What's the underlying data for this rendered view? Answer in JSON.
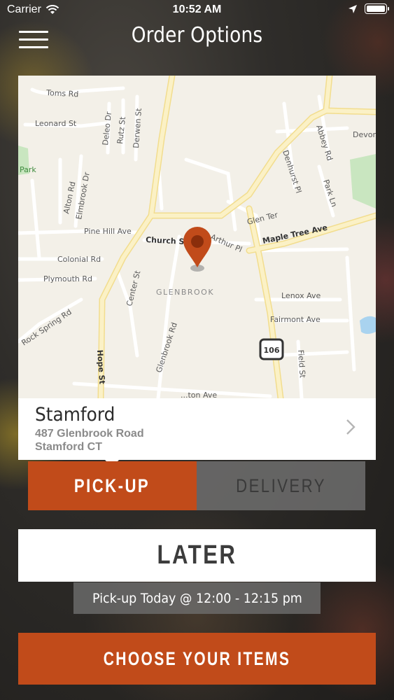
{
  "status_bar": {
    "carrier": "Carrier",
    "time": "10:52 AM"
  },
  "header": {
    "title": "Order Options"
  },
  "map": {
    "labels": {
      "toms_rd": "Toms Rd",
      "leonard_st": "Leonard St",
      "deleo_dr": "Deleo Dr",
      "rutz_st": "Rutz St",
      "derwen_st": "Derwen St",
      "park": "Park",
      "alton_rd": "Alton Rd",
      "elmbrook_dr": "Elmbrook Dr",
      "pine_hill_ave": "Pine Hill Ave",
      "church_st": "Church St",
      "arthur_pl": "Arthur Pl",
      "glen_ter": "Glen Ter",
      "maple_tree_ave": "Maple Tree Ave",
      "denhurst_pl": "Denhurst Pl",
      "abbey_rd": "Abbey Rd",
      "devon": "Devon",
      "park_ln": "Park Ln",
      "colonial_rd": "Colonial Rd",
      "plymouth_rd": "Plymouth Rd",
      "center_st": "Center St",
      "glenbrook": "GLENBROOK",
      "lenox_ave": "Lenox Ave",
      "fairmont_ave": "Fairmont Ave",
      "rock_spring_rd": "Rock Spring Rd",
      "glenbrook_rd": "Glenbrook Rd",
      "hope_st": "Hope St",
      "route": "106",
      "field_st": "Field St",
      "bottom_ave": "...ton Ave"
    },
    "colors": {
      "land": "#f3f0e8",
      "road": "#ffffff",
      "major_road": "#f7e8a8",
      "park": "#c9e6c0",
      "water": "#a9d3ef",
      "pin": "#c14b1a"
    }
  },
  "location": {
    "name": "Stamford",
    "address_line1": "487 Glenbrook Road",
    "address_line2": "Stamford CT"
  },
  "order_type": {
    "pickup_label": "PICK-UP",
    "delivery_label": "DELIVERY",
    "selected": "pickup"
  },
  "timing": {
    "later_label": "LATER",
    "info": "Pick-up Today @ 12:00 - 12:15 pm"
  },
  "cta": {
    "label": "CHOOSE YOUR ITEMS"
  },
  "colors": {
    "accent": "#c14b1a"
  }
}
